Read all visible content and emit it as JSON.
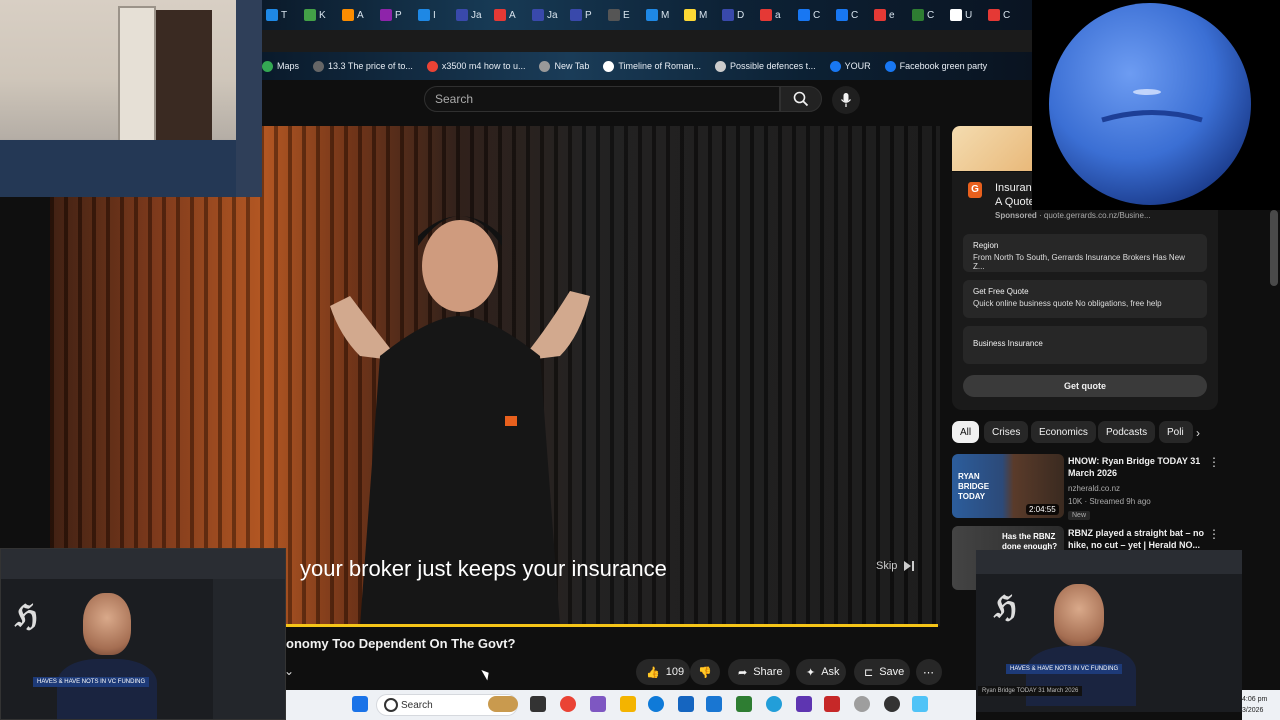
{
  "browser": {
    "tabs": [
      "T",
      "K",
      "A",
      "P",
      "I",
      "Ja",
      "A",
      "Ja",
      "P",
      "E",
      "M",
      "M",
      "D",
      "a",
      "C",
      "C",
      "e",
      "C",
      "U",
      "C"
    ],
    "bookmarks": [
      {
        "label": "Maps",
        "icon": "maps-icon"
      },
      {
        "label": "13.3 The price of to...",
        "icon": "doc-icon"
      },
      {
        "label": "x3500 m4 how to u...",
        "icon": "google-icon"
      },
      {
        "label": "New Tab",
        "icon": "tab-icon"
      },
      {
        "label": "Timeline of Roman...",
        "icon": "wikipedia-icon"
      },
      {
        "label": "Possible defences t...",
        "icon": "cl-icon"
      },
      {
        "label": "YOUR",
        "icon": "facebook-icon"
      },
      {
        "label": "Facebook green party",
        "icon": "facebook-icon"
      }
    ]
  },
  "youtube": {
    "search_placeholder": "Search",
    "video": {
      "caption": "your broker just keeps your insurance",
      "skip_label": "Skip",
      "title": "onomy Too Dependent On The Govt?",
      "likes": "109",
      "share_label": "Share",
      "ask_label": "Ask",
      "save_label": "Save"
    },
    "ad": {
      "logo": "G",
      "title_line1": "Insurance",
      "title_line2": "A Quote",
      "sponsored": "Sponsored",
      "domain": " · quote.gerrards.co.nz/Busine...",
      "rows": [
        {
          "title": "Region",
          "subtitle": "From North To South, Gerrards Insurance Brokers Has New Z..."
        },
        {
          "title": "Get Free Quote",
          "subtitle": "Quick online business quote No obligations, free help"
        },
        {
          "title": "Business Insurance",
          "subtitle": ""
        }
      ],
      "cta": "Get quote"
    },
    "chips": [
      "All",
      "Crises",
      "Economics",
      "Podcasts",
      "Poli"
    ],
    "recommended": [
      {
        "title": "HNOW: Ryan Bridge TODAY 31 March 2026",
        "channel": "nzherald.co.nz",
        "meta": "10K · Streamed 9h ago",
        "badge": "New",
        "duration": "2:04:55",
        "thumb_text": "RYAN BRIDGE TODAY"
      },
      {
        "title": "RBNZ played a straight bat – no hike, no cut – yet | Herald NO...",
        "thumb_text": "Has the RBNZ done enough?"
      }
    ]
  },
  "pip": {
    "headline": "HAVES & HAVE NOTS IN VC FUNDING",
    "ticker": "Ryan Bridge TODAY 31 March 2026"
  },
  "taskbar": {
    "search_placeholder": "Search",
    "time": "4:06 pm",
    "date": "3/2026"
  },
  "colors": {
    "background": "#0f0f0f",
    "progress": "#f5c518",
    "ad_logo": "#e8601d",
    "planet": "#3b6fd4"
  }
}
